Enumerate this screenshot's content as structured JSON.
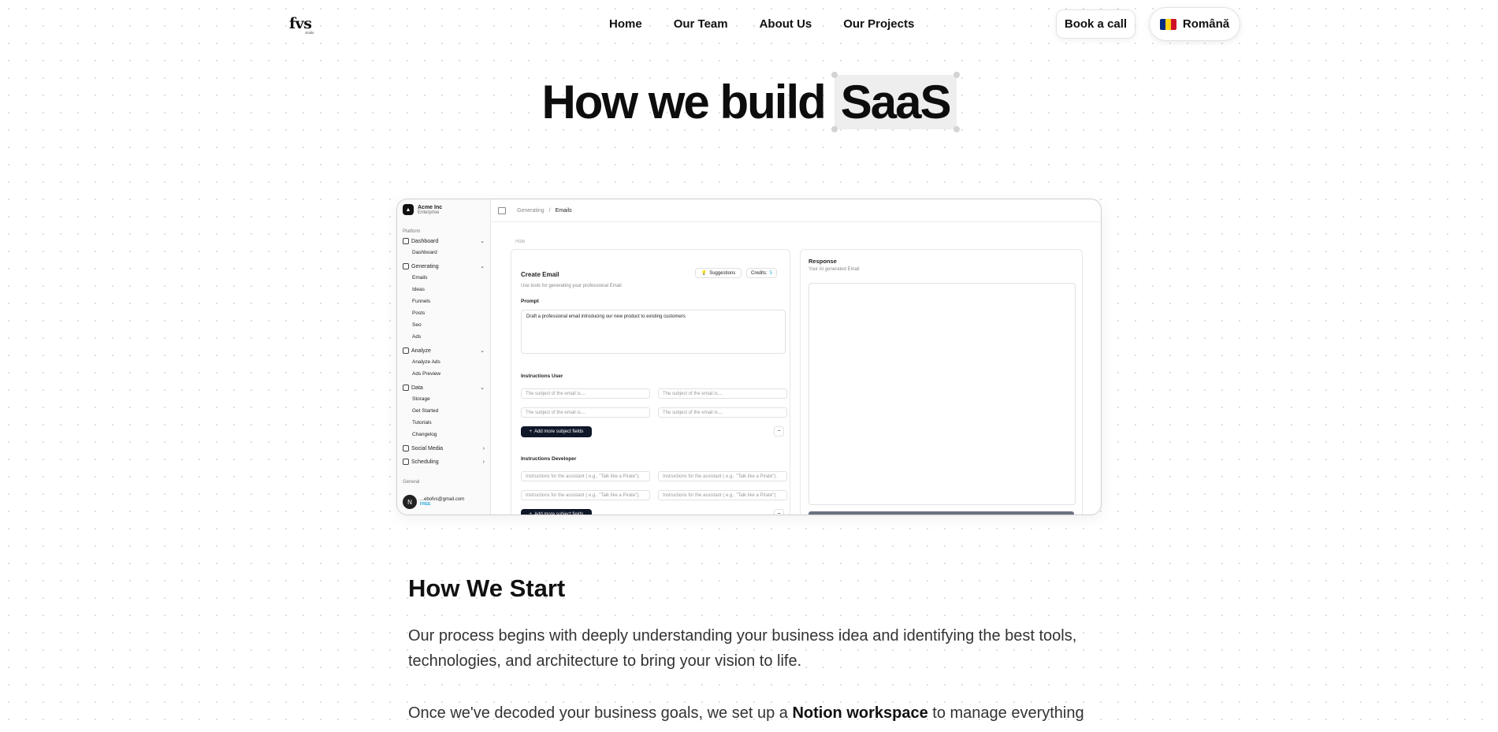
{
  "nav": {
    "logo": "fvs",
    "logo_sub": "studio",
    "links": [
      "Home",
      "Our Team",
      "About Us",
      "Our Projects"
    ],
    "book_call": "Book a call",
    "language": "Română",
    "flag_colors": [
      "#002B7F",
      "#FCD116",
      "#CE1126"
    ]
  },
  "hero": {
    "title_prefix": "How we build",
    "title_highlight": "SaaS"
  },
  "app": {
    "org_name": "Acme Inc",
    "org_plan": "Enterprise",
    "platform_label": "Platform",
    "general_label": "General",
    "menu": [
      {
        "label": "Dashboard",
        "icon": "grid-icon",
        "chevron": "⌄",
        "subs": [
          "Dashboard"
        ]
      },
      {
        "label": "Generating",
        "icon": "wand-icon",
        "chevron": "⌄",
        "subs": [
          "Emails",
          "Ideas",
          "Funnels",
          "Posts",
          "Seo",
          "Ads"
        ]
      },
      {
        "label": "Analyze",
        "icon": "calculator-icon",
        "chevron": "⌄",
        "subs": [
          "Analyze Ads",
          "Ads Preview"
        ]
      },
      {
        "label": "Data",
        "icon": "database-icon",
        "chevron": "⌄",
        "subs": [
          "Storage",
          "Get Started",
          "Tutorials",
          "Changelog"
        ]
      },
      {
        "label": "Social Media",
        "icon": "share-icon",
        "chevron": "›",
        "subs": []
      },
      {
        "label": "Scheduling",
        "icon": "calendar-icon",
        "chevron": "›",
        "subs": []
      }
    ],
    "user_avatar": "N",
    "user_email": "...ebofvs@gmail.com",
    "user_plan": "FREE",
    "breadcrumb": [
      "Generating",
      "Emails"
    ],
    "hide_label": "Hide",
    "create_title": "Create Email",
    "create_desc": "Use tools for generating your professional Email",
    "suggestions": "Suggestions",
    "credits_label": "Credits:",
    "credits_value": "5",
    "prompt_label": "Prompt",
    "prompt_value": "Draft a professional email introducing our new product to existing customers",
    "instructions_user_label": "Instructions User",
    "user_placeholder": "The subject of the email is....",
    "add_more": "Add more subject fields",
    "instructions_dev_label": "Instructions Developer",
    "dev_placeholder": "Instructions for the assistant ( e.g.. \"Talk like a Pirate\").",
    "minus": "−",
    "response_title": "Response",
    "response_desc": "Your AI generated Email"
  },
  "section": {
    "heading": "How We Start",
    "para1": "Our process begins with deeply understanding your business idea and identifying the best tools, technologies, and architecture to bring your vision to life.",
    "para2_a": "Once we've decoded your business goals, we set up a ",
    "para2_b": "Notion workspace",
    "para2_c": " to manage everything"
  }
}
